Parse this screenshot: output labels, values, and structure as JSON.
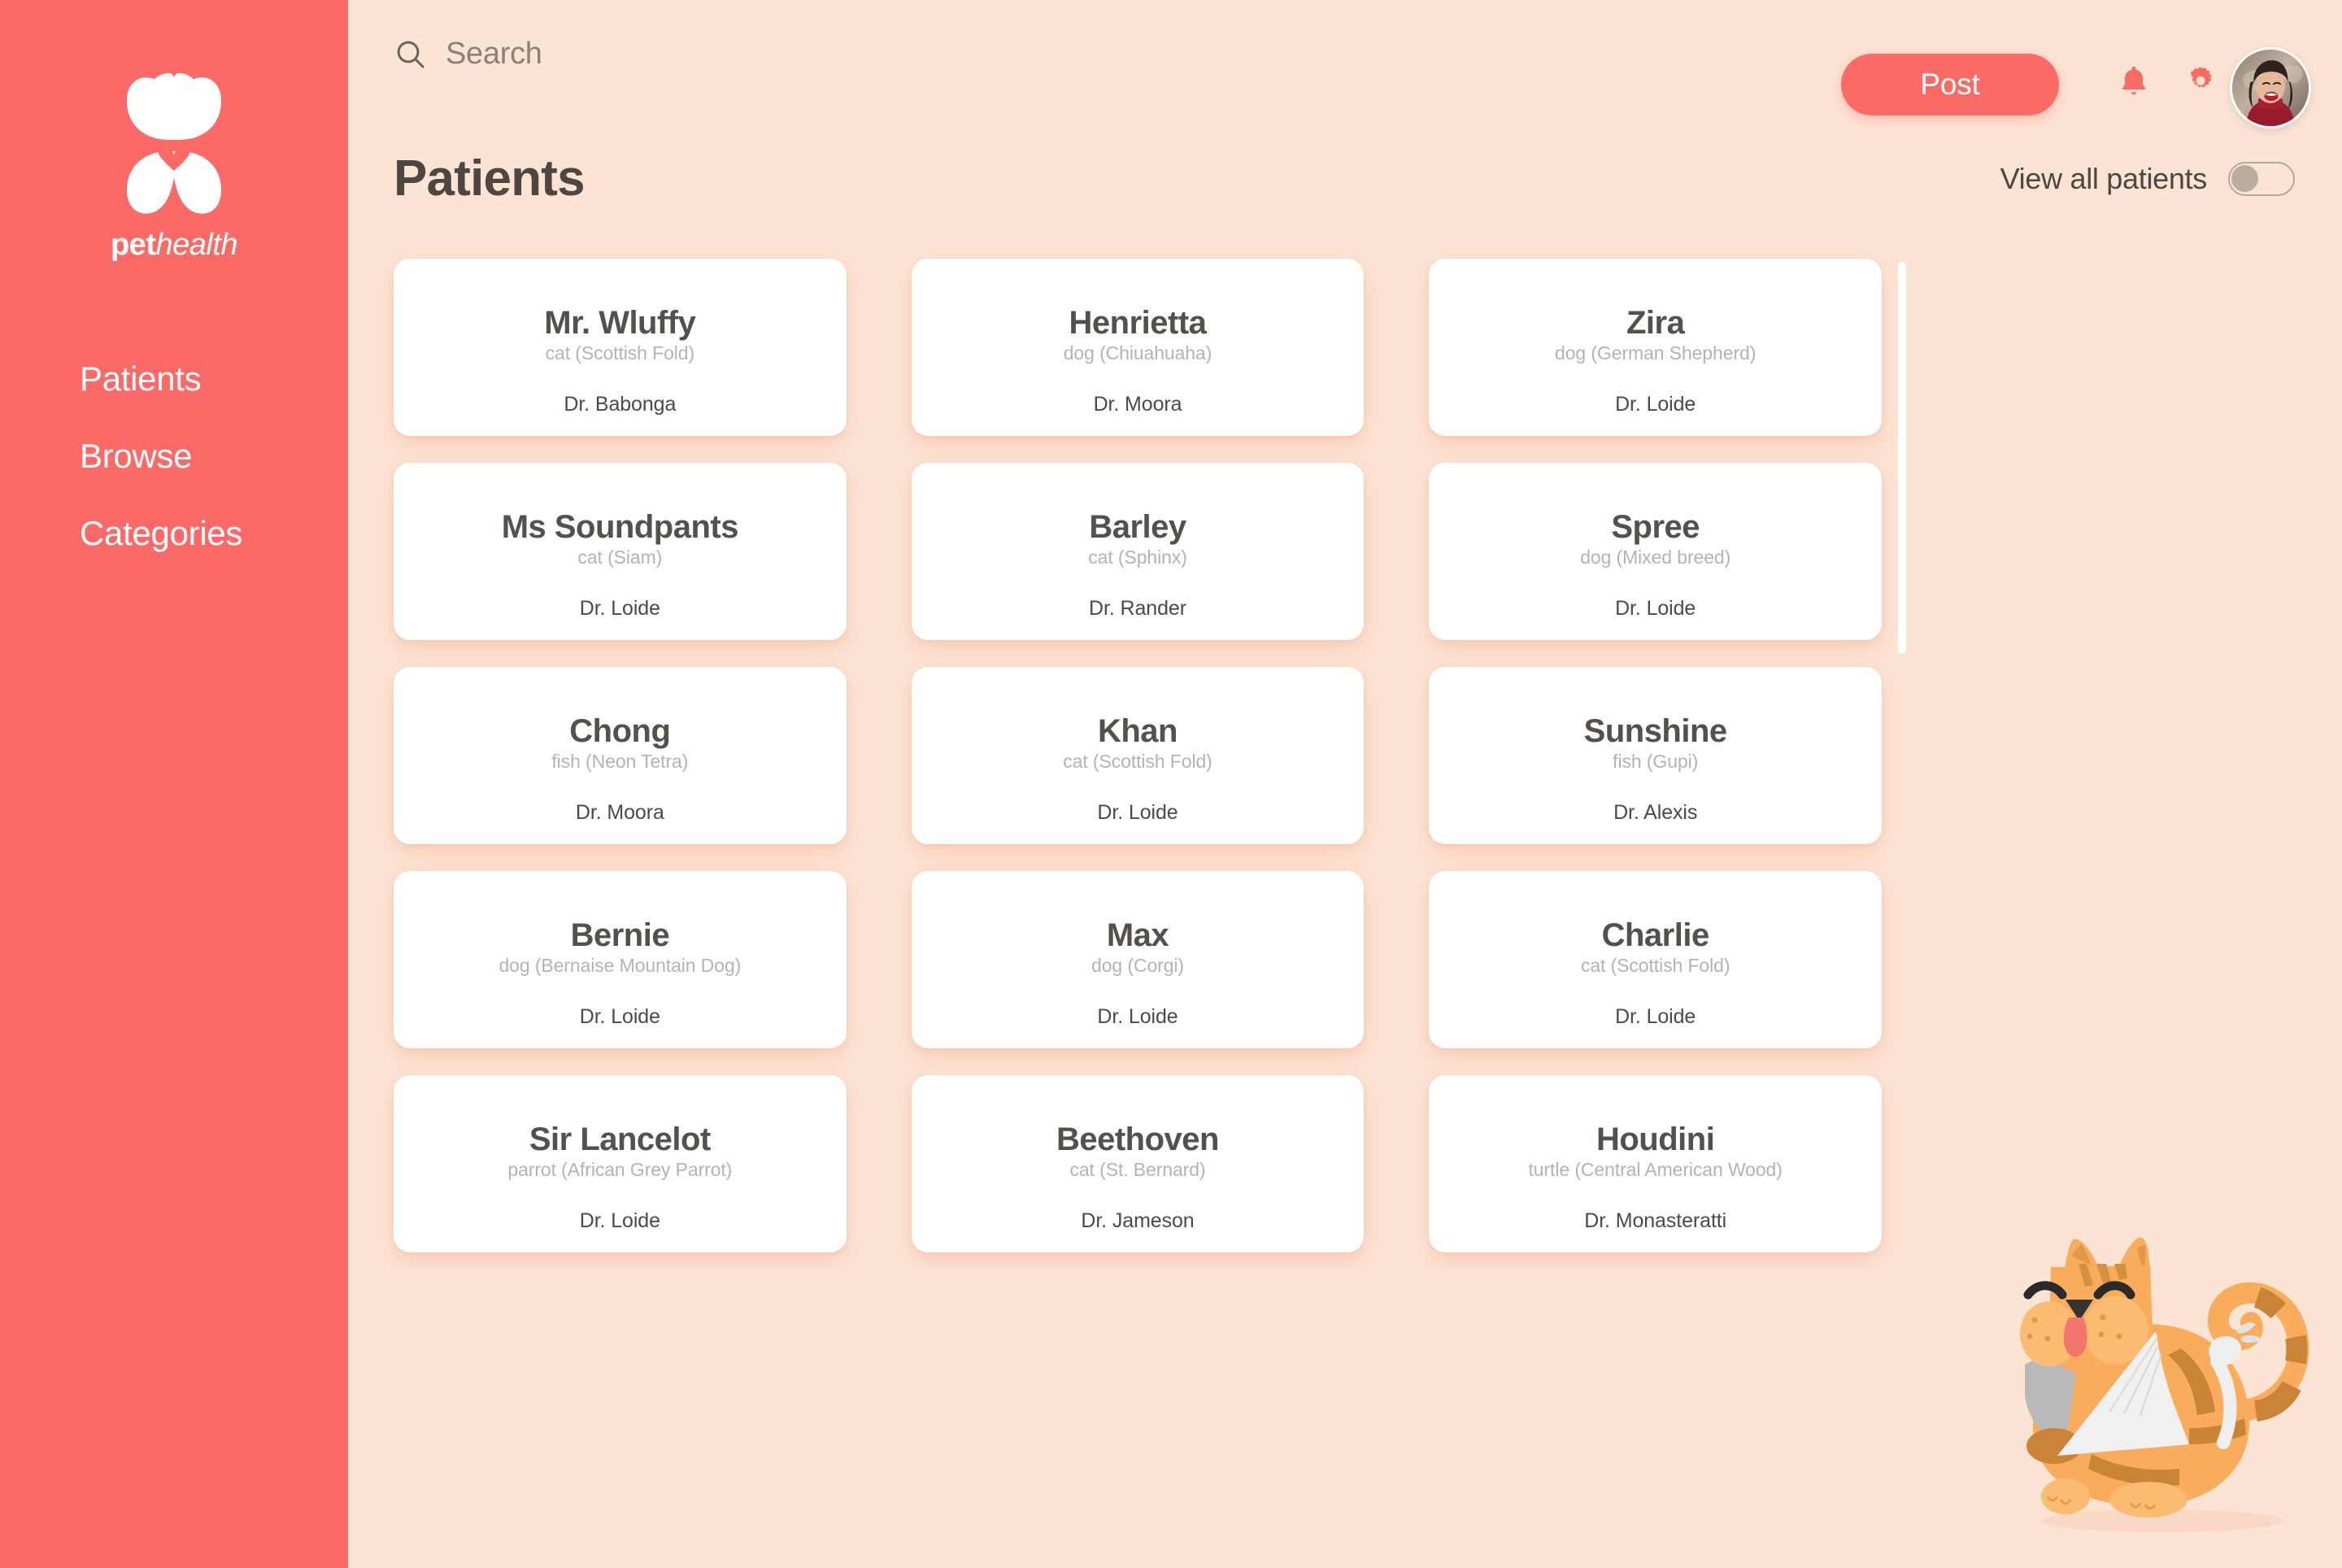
{
  "brand": {
    "logo_icon": "bunny-butterfly-heart-logo",
    "name_bold": "pet",
    "name_italic": "health",
    "sidebar_color": "#fc6a68",
    "accent_color": "#fb6a64",
    "background_color": "#fce4d4",
    "card_color": "#ffffff"
  },
  "sidebar": {
    "items": [
      {
        "label": "Patients"
      },
      {
        "label": "Browse"
      },
      {
        "label": "Categories"
      }
    ]
  },
  "topbar": {
    "search": {
      "value": "",
      "placeholder": "Search",
      "icon": "search-icon"
    },
    "post_label": "Post",
    "notifications_icon": "bell-icon",
    "settings_icon": "gear-icon",
    "avatar_alt": "user-avatar"
  },
  "page": {
    "title": "Patients",
    "toggle": {
      "label": "View all patients",
      "checked": false
    }
  },
  "patients": [
    {
      "name": "Mr. Wluffy",
      "breed": "cat (Scottish Fold)",
      "doctor": "Dr. Babonga"
    },
    {
      "name": "Henrietta",
      "breed": "dog (Chiuahuaha)",
      "doctor": "Dr. Moora"
    },
    {
      "name": "Zira",
      "breed": "dog (German Shepherd)",
      "doctor": "Dr. Loide"
    },
    {
      "name": "Ms Soundpants",
      "breed": "cat (Siam)",
      "doctor": "Dr. Loide"
    },
    {
      "name": "Barley",
      "breed": "cat (Sphinx)",
      "doctor": "Dr. Rander"
    },
    {
      "name": "Spree",
      "breed": "dog (Mixed breed)",
      "doctor": "Dr. Loide"
    },
    {
      "name": "Chong",
      "breed": "fish (Neon Tetra)",
      "doctor": "Dr. Moora"
    },
    {
      "name": "Khan",
      "breed": "cat (Scottish Fold)",
      "doctor": "Dr. Loide"
    },
    {
      "name": "Sunshine",
      "breed": "fish (Gupi)",
      "doctor": "Dr. Alexis"
    },
    {
      "name": "Bernie",
      "breed": "dog (Bernaise Mountain Dog)",
      "doctor": "Dr. Loide"
    },
    {
      "name": "Max",
      "breed": "dog (Corgi)",
      "doctor": "Dr. Loide"
    },
    {
      "name": "Charlie",
      "breed": "cat (Scottish Fold)",
      "doctor": "Dr. Loide"
    },
    {
      "name": "Sir Lancelot",
      "breed": "parrot (African Grey Parrot)",
      "doctor": "Dr. Loide"
    },
    {
      "name": "Beethoven",
      "breed": "cat (St. Bernard)",
      "doctor": "Dr. Jameson"
    },
    {
      "name": "Houdini",
      "breed": "turtle (Central American Wood)",
      "doctor": "Dr. Monasteratti"
    }
  ],
  "mascot": {
    "alt": "injured-orange-cat-illustration"
  }
}
